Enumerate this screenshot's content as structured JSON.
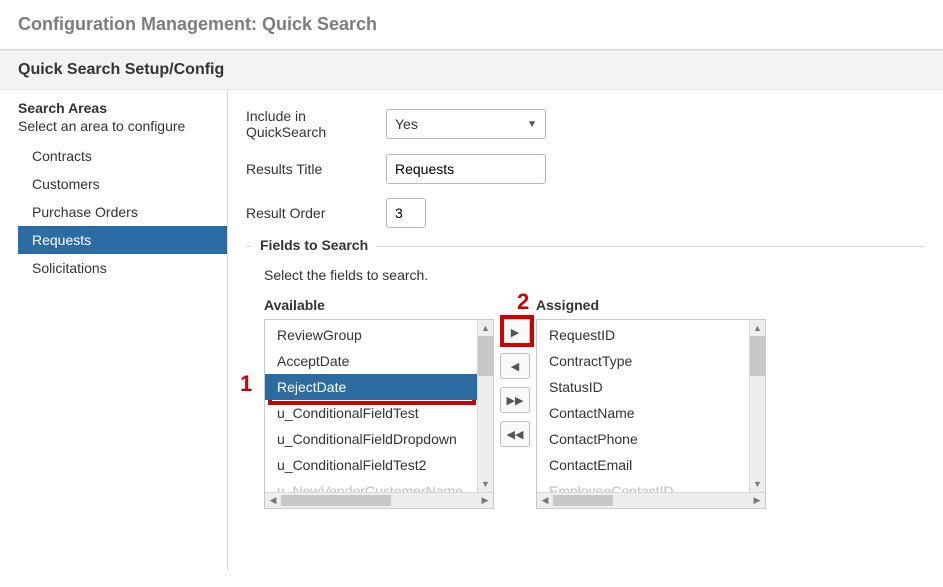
{
  "page": {
    "title": "Configuration Management: Quick Search",
    "panel_title": "Quick Search Setup/Config"
  },
  "sidebar": {
    "heading": "Search Areas",
    "subheading": "Select an area to configure",
    "items": [
      {
        "label": "Contracts",
        "selected": false
      },
      {
        "label": "Customers",
        "selected": false
      },
      {
        "label": "Purchase Orders",
        "selected": false
      },
      {
        "label": "Requests",
        "selected": true
      },
      {
        "label": "Solicitations",
        "selected": false
      }
    ]
  },
  "form": {
    "include_label": "Include in QuickSearch",
    "include_value": "Yes",
    "results_title_label": "Results Title",
    "results_title_value": "Requests",
    "result_order_label": "Result Order",
    "result_order_value": "3"
  },
  "fields_section": {
    "legend": "Fields to Search",
    "subtext": "Select the fields to search.",
    "available_label": "Available",
    "assigned_label": "Assigned",
    "available": [
      {
        "label": "ReviewGroup"
      },
      {
        "label": "AcceptDate"
      },
      {
        "label": "RejectDate",
        "selected": true
      },
      {
        "label": "u_ConditionalFieldTest"
      },
      {
        "label": "u_ConditionalFieldDropdown"
      },
      {
        "label": "u_ConditionalFieldTest2"
      },
      {
        "label": "u_NewVendorCustomerName",
        "cutoff": true
      }
    ],
    "assigned": [
      {
        "label": "RequestID"
      },
      {
        "label": "ContractType"
      },
      {
        "label": "StatusID"
      },
      {
        "label": "ContactName"
      },
      {
        "label": "ContactPhone"
      },
      {
        "label": "ContactEmail"
      },
      {
        "label": "EmployeeContactID",
        "cutoff": true
      }
    ]
  },
  "annotations": {
    "one": "1",
    "two": "2",
    "highlight_item_index": 2,
    "highlight_button": "add-one"
  },
  "colors": {
    "selected_bg": "#2d6ca2",
    "annotation": "#d20000"
  }
}
